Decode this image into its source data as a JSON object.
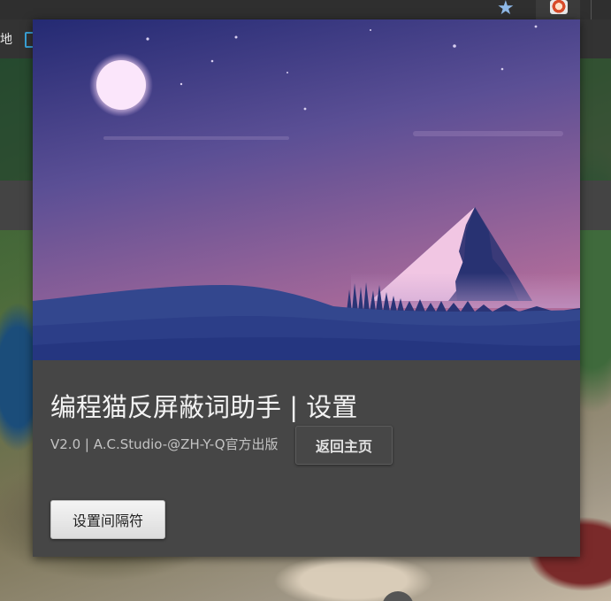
{
  "browser": {
    "bookmark_text": "地",
    "star_icon": "star-icon",
    "extension_icon": "avatar-icon"
  },
  "card": {
    "title": "编程猫反屏蔽词助手 | 设置",
    "subtitle": "V2.0 | A.C.Studio-@ZH-Y-Q官方出版",
    "back_home_label": "返回主页",
    "separator_label": "设置间隔符"
  },
  "colors": {
    "card_bg": "#464646",
    "sky_top": "#252a74",
    "sky_bottom": "#b06c9a",
    "moon": "#fbe6fb",
    "mountain": "#2a3670",
    "snow": "#f1c6e3",
    "hills": "#2d3d86"
  }
}
